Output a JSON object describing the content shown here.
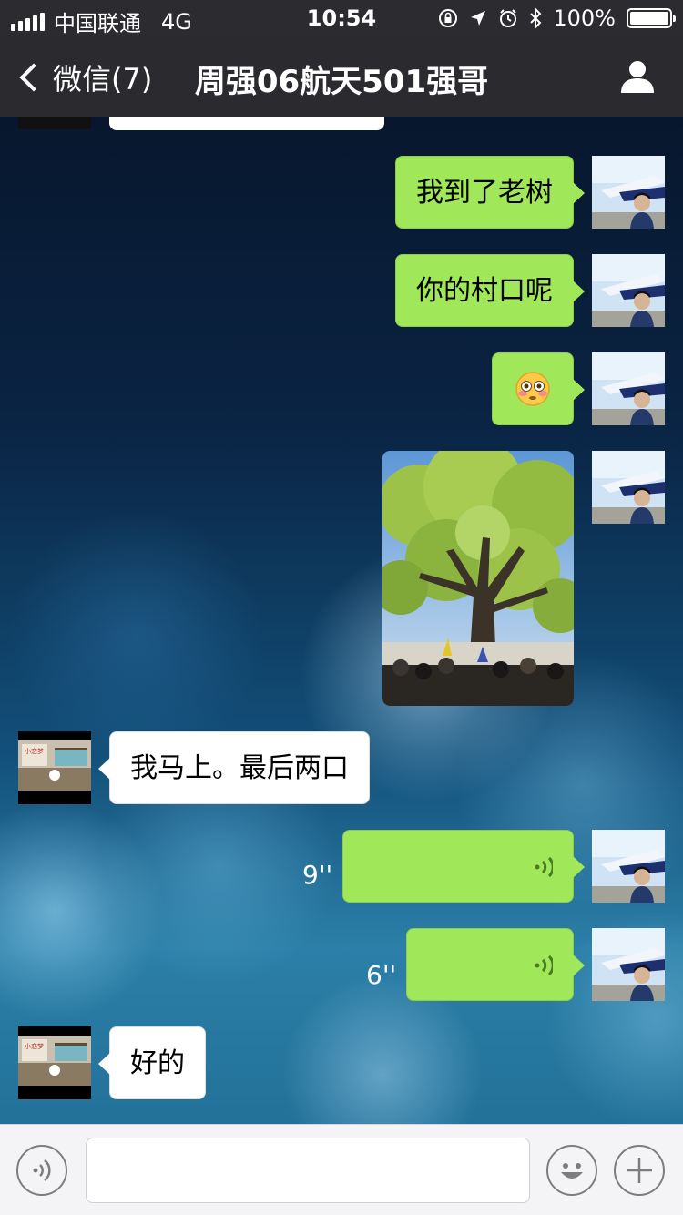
{
  "status_bar": {
    "carrier": "中国联通",
    "network": "4G",
    "time": "10:54",
    "battery": "100%"
  },
  "nav": {
    "back_label": "微信(7)",
    "title": "周强06航天501强哥",
    "person_icon": "person-icon"
  },
  "messages": [
    {
      "from": "me",
      "type": "text",
      "text": "我到了老树"
    },
    {
      "from": "me",
      "type": "text",
      "text": "你的村口呢"
    },
    {
      "from": "me",
      "type": "emoji",
      "text": "😳"
    },
    {
      "from": "me",
      "type": "image",
      "icon": "photo-tree"
    },
    {
      "from": "them",
      "type": "text",
      "text": "我马上。最后两口"
    },
    {
      "from": "me",
      "type": "voice",
      "duration": "9''"
    },
    {
      "from": "me",
      "type": "voice",
      "duration": "6''"
    },
    {
      "from": "them",
      "type": "text",
      "text": "好的"
    }
  ],
  "input": {
    "placeholder": "",
    "voice_icon": "voice-mode-icon",
    "emoji_icon": "emoji-icon",
    "plus_icon": "plus-icon"
  },
  "colors": {
    "my_bubble": "#a0e75a",
    "their_bubble": "#ffffff",
    "nav_bg": "#2b2b30"
  }
}
